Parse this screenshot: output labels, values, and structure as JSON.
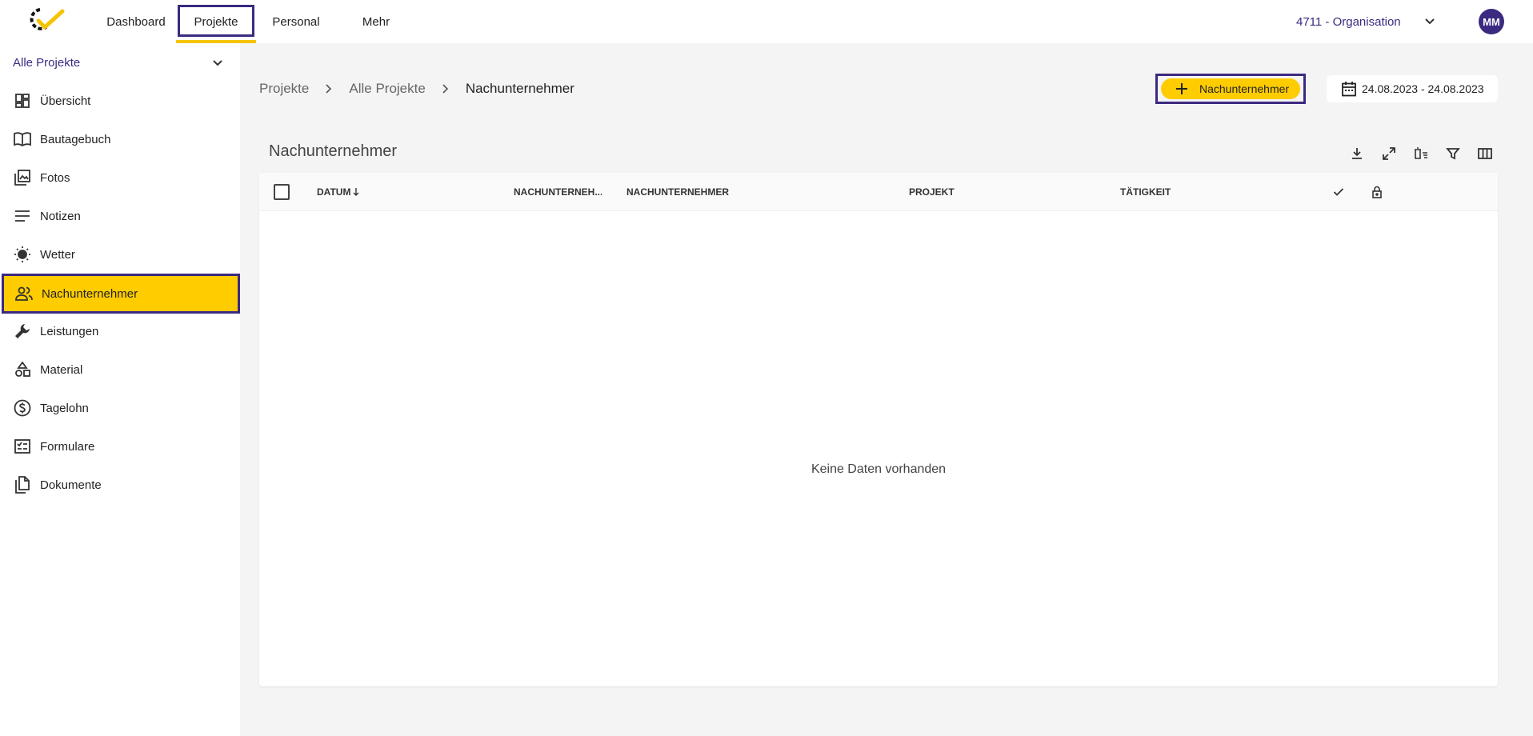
{
  "topbar": {
    "nav": [
      "Dashboard",
      "Projekte",
      "Personal",
      "Mehr"
    ],
    "organisation": "4711 - Organisation",
    "avatar_initials": "MM",
    "accent_color": "#ffcc00",
    "brand_color": "#3b2a80"
  },
  "sidebar": {
    "project_select": "Alle Projekte",
    "items": [
      {
        "label": "Übersicht",
        "icon": "dashboard-icon"
      },
      {
        "label": "Bautagebuch",
        "icon": "book-icon"
      },
      {
        "label": "Fotos",
        "icon": "photos-icon"
      },
      {
        "label": "Notizen",
        "icon": "notes-icon"
      },
      {
        "label": "Wetter",
        "icon": "sun-icon"
      },
      {
        "label": "Nachunternehmer",
        "icon": "people-icon"
      },
      {
        "label": "Leistungen",
        "icon": "wrench-icon"
      },
      {
        "label": "Material",
        "icon": "shapes-icon"
      },
      {
        "label": "Tagelohn",
        "icon": "dollar-icon"
      },
      {
        "label": "Formulare",
        "icon": "form-icon"
      },
      {
        "label": "Dokumente",
        "icon": "documents-icon"
      }
    ],
    "active": "Nachunternehmer"
  },
  "breadcrumb": [
    "Projekte",
    "Alle Projekte",
    "Nachunternehmer"
  ],
  "actions": {
    "add_label": "Nachunternehmer",
    "date_range": "24.08.2023 - 24.08.2023"
  },
  "panel": {
    "title": "Nachunternehmer",
    "tools": [
      "download-icon",
      "expand-icon",
      "clear-filter-icon",
      "filter-icon",
      "columns-icon"
    ]
  },
  "table": {
    "columns": [
      "DATUM",
      "NACHUNTERNEH...",
      "NACHUNTERNEHMER",
      "PROJEKT",
      "TÄTIGKEIT"
    ],
    "empty_text": "Keine Daten vorhanden"
  }
}
